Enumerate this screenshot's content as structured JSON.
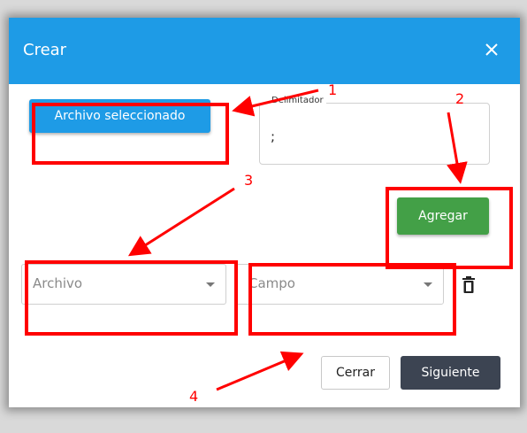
{
  "dialog": {
    "title": "Crear",
    "close_icon": "close-icon",
    "select_file_label": "Archivo seleccionado",
    "delimiter": {
      "label": "Delimitador",
      "value": ";"
    },
    "add_label": "Agregar",
    "file_select": {
      "placeholder": "Archivo"
    },
    "field_select": {
      "placeholder": "Campo"
    },
    "delete_icon": "trash-icon",
    "cancel_label": "Cerrar",
    "next_label": "Siguiente"
  },
  "annotations": {
    "markers": [
      "1",
      "2",
      "3",
      "4"
    ],
    "color": "#ff0000"
  },
  "colors": {
    "header": "#1e9be6",
    "primary_button": "#1e9be6",
    "add_button": "#43a047",
    "next_button": "#3c4452"
  }
}
